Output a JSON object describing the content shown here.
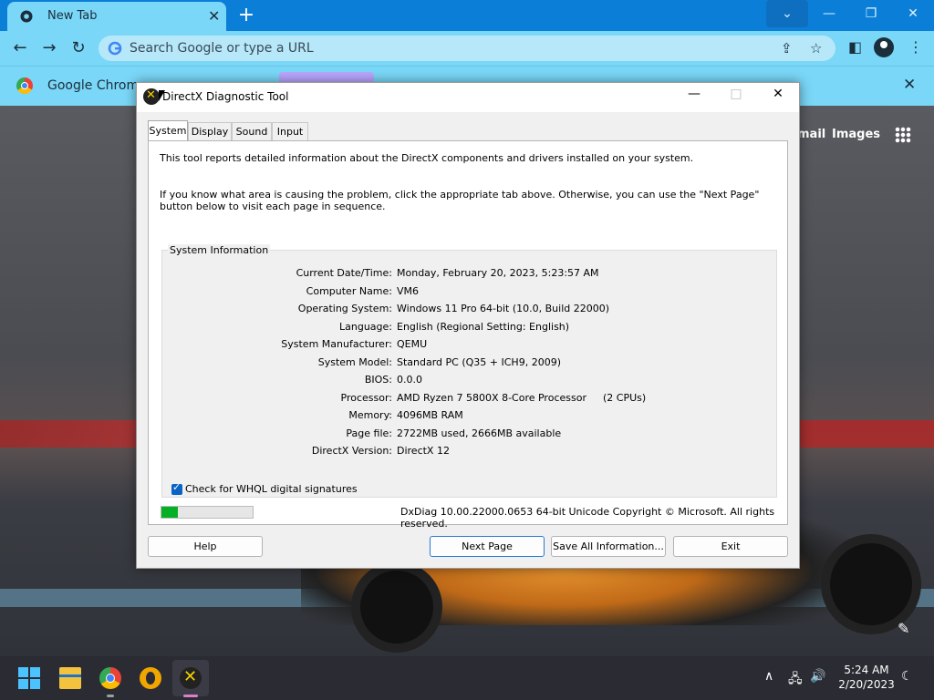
{
  "browser": {
    "tab_title": "New Tab",
    "omnibox_placeholder": "Search Google or type a URL",
    "infobar_text": "Google Chrome"
  },
  "newtab_page": {
    "gmail_label": "mail",
    "images_label": "Images"
  },
  "dialog": {
    "title": "DirectX Diagnostic Tool",
    "tabs": [
      "System",
      "Display",
      "Sound",
      "Input"
    ],
    "active_tab": "System",
    "intro_1": "This tool reports detailed information about the DirectX components and drivers installed on your system.",
    "intro_2": "If you know what area is causing the problem, click the appropriate tab above.  Otherwise, you can use the \"Next Page\" button below to visit each page in sequence.",
    "group_title": "System Information",
    "rows": [
      {
        "key": "Current Date/Time:",
        "value": "Monday, February 20, 2023, 5:23:57 AM"
      },
      {
        "key": "Computer Name:",
        "value": "VM6"
      },
      {
        "key": "Operating System:",
        "value": "Windows 11 Pro 64-bit (10.0, Build 22000)"
      },
      {
        "key": "Language:",
        "value": "English (Regional Setting: English)"
      },
      {
        "key": "System Manufacturer:",
        "value": "QEMU"
      },
      {
        "key": "System Model:",
        "value": "Standard PC (Q35 + ICH9, 2009)"
      },
      {
        "key": "BIOS:",
        "value": "0.0.0"
      },
      {
        "key": "Processor:",
        "value": "AMD Ryzen 7 5800X 8-Core Processor",
        "value2": "(2 CPUs)"
      },
      {
        "key": "Memory:",
        "value": "4096MB RAM"
      },
      {
        "key": "Page file:",
        "value": "2722MB used, 2666MB available"
      },
      {
        "key": "DirectX Version:",
        "value": "DirectX 12"
      }
    ],
    "whql_label": "Check for WHQL digital signatures",
    "whql_checked": true,
    "progress_fraction": 0.18,
    "copyright": "DxDiag 10.00.22000.0653 64-bit Unicode  Copyright © Microsoft. All rights reserved.",
    "buttons": {
      "help": "Help",
      "next_page": "Next Page",
      "save_all": "Save All Information...",
      "exit": "Exit"
    }
  },
  "taskbar": {
    "time": "5:24 AM",
    "date": "2/20/2023"
  },
  "colors": {
    "chrome_tabstrip": "#0b7fd8",
    "chrome_toolbar": "#7ad7f7",
    "progress_fill": "#06b025",
    "taskbar_bg": "#2b2c33",
    "checkbox_accent": "#0a64c4"
  }
}
